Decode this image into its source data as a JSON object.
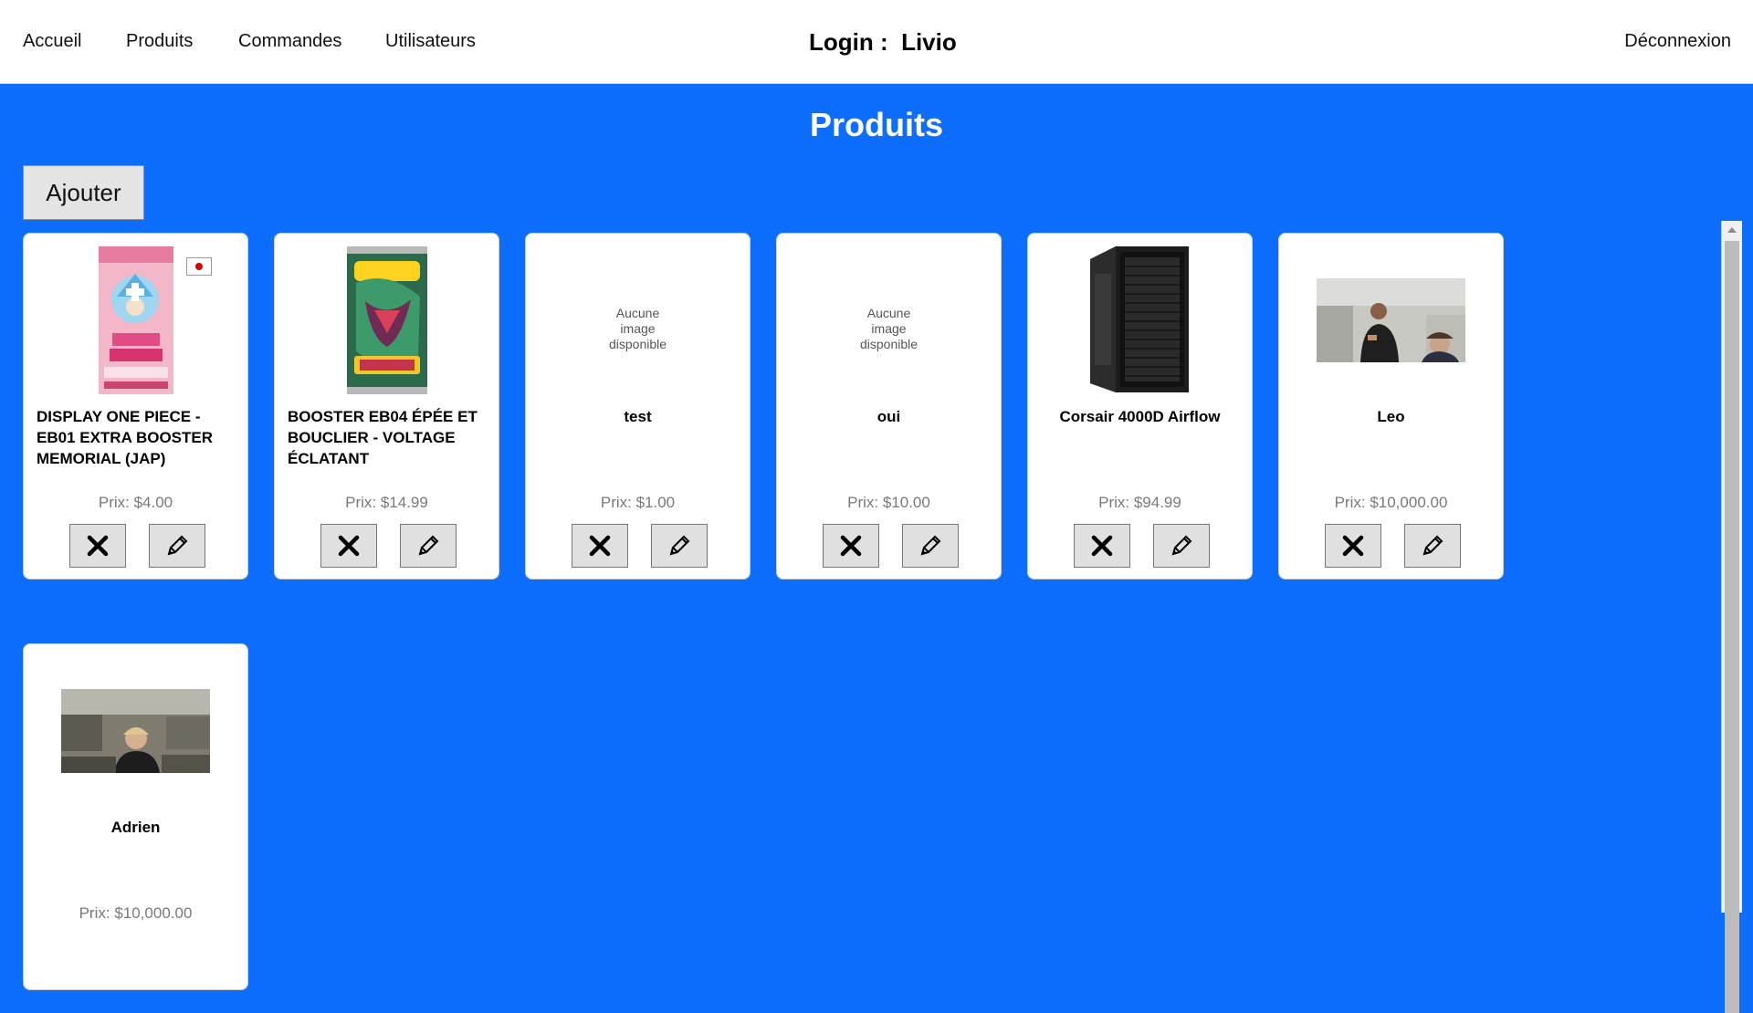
{
  "nav": {
    "home": "Accueil",
    "products": "Produits",
    "orders": "Commandes",
    "users": "Utilisateurs",
    "login_label": "Login :  Livio",
    "logout": "Déconnexion"
  },
  "page": {
    "title": "Produits",
    "add_button": "Ajouter"
  },
  "products": [
    {
      "name": "DISPLAY ONE PIECE - EB01 EXTRA BOOSTER MEMORIAL (JAP)",
      "price": "Prix: $4.00",
      "image": "one-piece-display"
    },
    {
      "name": "BOOSTER EB04 ÉPÉE ET BOUCLIER - VOLTAGE ÉCLATANT",
      "price": "Prix: $14.99",
      "image": "pokemon-booster"
    },
    {
      "name": "test",
      "price": "Prix: $1.00",
      "no_image_text": "Aucune image disponible"
    },
    {
      "name": "oui",
      "price": "Prix: $10.00",
      "no_image_text": "Aucune image disponible"
    },
    {
      "name": "Corsair 4000D Airflow",
      "price": "Prix: $94.99",
      "image": "pc-case"
    },
    {
      "name": "Leo",
      "price": "Prix: $10,000.00",
      "image": "photo-people"
    },
    {
      "name": "Adrien",
      "price": "Prix: $10,000.00",
      "image": "photo-person"
    }
  ],
  "icons": {
    "delete": "close-icon",
    "edit": "pencil-icon"
  },
  "colors": {
    "background": "#0d6efd",
    "card": "#ffffff",
    "button": "#e0e0e0"
  }
}
